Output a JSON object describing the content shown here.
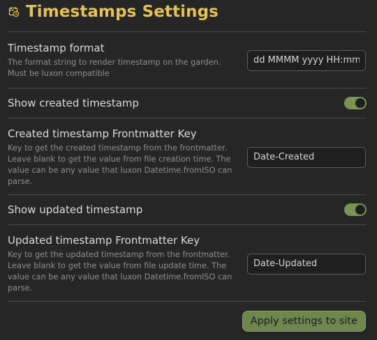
{
  "header": {
    "title": "Timestamps Settings",
    "icon": "calendar-clock-icon",
    "title_color": "#e5c155"
  },
  "settings": {
    "timestamp_format": {
      "name": "Timestamp format",
      "description": "The format string to render timestamp on the garden. Must be luxon compatible",
      "value": "dd MMMM yyyy HH:mm"
    },
    "show_created": {
      "name": "Show created timestamp",
      "enabled": true
    },
    "created_key": {
      "name": "Created timestamp Frontmatter Key",
      "description": "Key to get the created timestamp from the frontmatter. Leave blank to get the value from file creation time. The value can be any value that luxon Datetime.fromISO can parse.",
      "value": "Date-Created"
    },
    "show_updated": {
      "name": "Show updated timestamp",
      "enabled": true
    },
    "updated_key": {
      "name": "Updated timestamp Frontmatter Key",
      "description": "Key to get the updated timestamp from the frontmatter. Leave blank to get the value from file update time. The value can be any value that luxon Datetime.fromISO can parse.",
      "value": "Date-Updated"
    }
  },
  "footer": {
    "apply_label": "Apply settings to site"
  },
  "colors": {
    "accent": "#7b9456",
    "background": "#262626"
  }
}
